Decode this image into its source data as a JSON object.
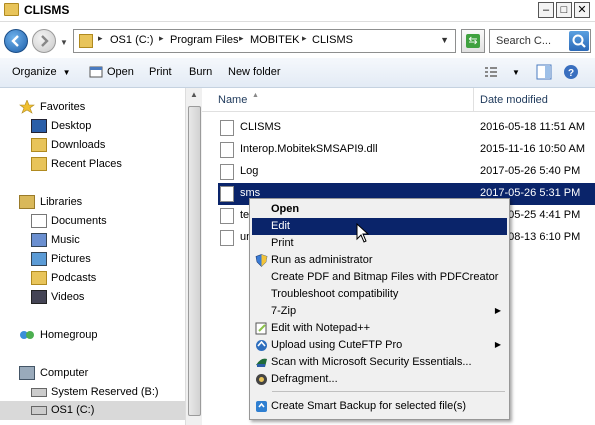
{
  "window": {
    "title": "CLISMS"
  },
  "address": {
    "crumbs": [
      "OS1 (C:)",
      "Program Files",
      "MOBITEK",
      "CLISMS"
    ],
    "search_placeholder": "Search C..."
  },
  "toolbar": {
    "organize": "Organize",
    "open": "Open",
    "print": "Print",
    "burn": "Burn",
    "new_folder": "New folder"
  },
  "nav": {
    "favorites": "Favorites",
    "desktop": "Desktop",
    "downloads": "Downloads",
    "recent": "Recent Places",
    "libraries": "Libraries",
    "documents": "Documents",
    "music": "Music",
    "pictures": "Pictures",
    "podcasts": "Podcasts",
    "videos": "Videos",
    "homegroup": "Homegroup",
    "computer": "Computer",
    "sysres": "System Reserved (B:)",
    "os1": "OS1 (C:)"
  },
  "columns": {
    "name": "Name",
    "date": "Date modified"
  },
  "files": [
    {
      "name": "CLISMS",
      "date": "2016-05-18 11:51 AM"
    },
    {
      "name": "Interop.MobitekSMSAPI9.dll",
      "date": "2015-11-16 10:50 AM"
    },
    {
      "name": "Log",
      "date": "2017-05-26 5:40 PM"
    },
    {
      "name": "sms",
      "date": "2017-05-26 5:31 PM"
    },
    {
      "name": "te",
      "date": "2017-05-25 4:41 PM"
    },
    {
      "name": "un",
      "date": "2008-08-13 6:10 PM"
    }
  ],
  "menu": {
    "open": "Open",
    "edit": "Edit",
    "print": "Print",
    "runas": "Run as administrator",
    "pdf": "Create PDF and Bitmap Files with PDFCreator",
    "troubleshoot": "Troubleshoot compatibility",
    "zip": "7-Zip",
    "notepad": "Edit with Notepad++",
    "cuteftp": "Upload using CuteFTP Pro",
    "mse": "Scan with Microsoft Security Essentials...",
    "defrag": "Defragment...",
    "backup": "Create Smart Backup for selected file(s)"
  },
  "colors": {
    "selection": "#0a246a",
    "toolbar_bg": "#e3ebf5"
  }
}
